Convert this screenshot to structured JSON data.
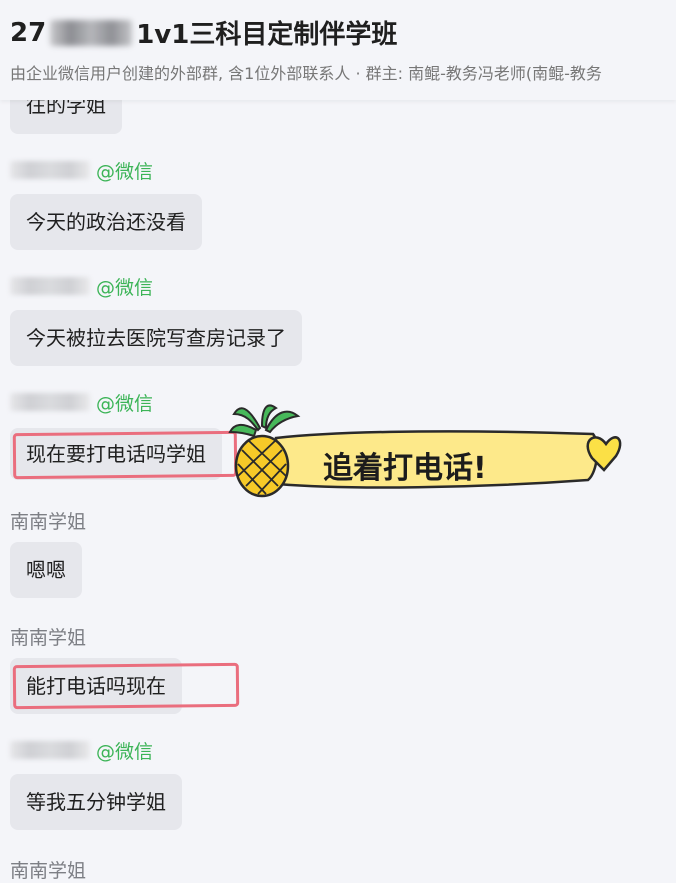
{
  "header": {
    "title_prefix": "27",
    "title_suffix": "1v1三科目定制伴学班",
    "subtitle": "由企业微信用户创建的外部群, 含1位外部联系人 · 群主: 南鲲-教务冯老师(南鲲-教务"
  },
  "messages": [
    {
      "text": "往的学姐"
    },
    {
      "sender_suffix": "@微信",
      "text": "今天的政治还没看"
    },
    {
      "sender_suffix": "@微信",
      "text": "今天被拉去医院写查房记录了"
    },
    {
      "sender_suffix": "@微信",
      "text": "现在要打电话吗学姐"
    },
    {
      "sender": "南南学姐",
      "text": "嗯嗯"
    },
    {
      "sender": "南南学姐",
      "text": "能打电话吗现在"
    },
    {
      "sender_suffix": "@微信",
      "text": "等我五分钟学姐"
    },
    {
      "sender": "南南学姐"
    }
  ],
  "sticker": {
    "text": "追着打电话!",
    "icons": [
      "pineapple-icon",
      "heart-icon"
    ],
    "banner_color": "#fde98a",
    "pineapple_color": "#f6c928",
    "heart_color": "#fbe046"
  },
  "colors": {
    "background": "#f4f5f9",
    "bubble": "#e6e7ec",
    "wechat_green": "#3cb457",
    "highlight_red": "#ea6e7e"
  }
}
